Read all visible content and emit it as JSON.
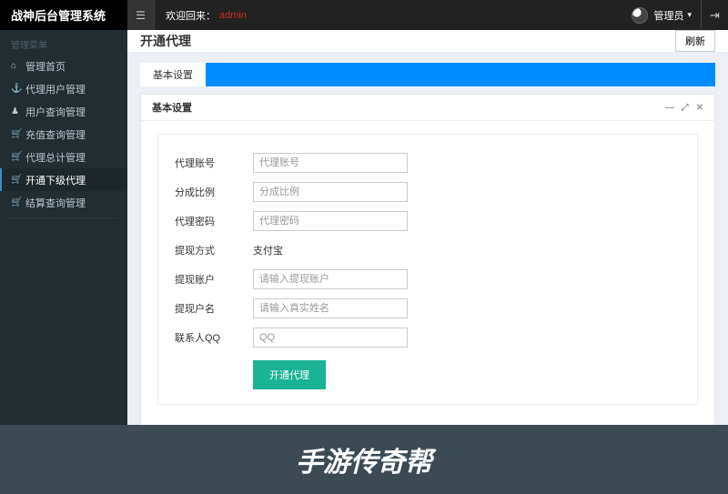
{
  "header": {
    "brand": "战神后台管理系统",
    "welcome_prefix": "欢迎回来：",
    "username": "admin",
    "role_label": "管理员"
  },
  "sidebar": {
    "section_label": "管理菜单",
    "items": [
      {
        "icon": "home-icon",
        "label": "管理首页",
        "glyph": "⌂"
      },
      {
        "icon": "sitemap-icon",
        "label": "代理用户管理",
        "glyph": "⚓"
      },
      {
        "icon": "user-icon",
        "label": "用户查询管理",
        "glyph": "♟"
      },
      {
        "icon": "cart-icon",
        "label": "充值查询管理",
        "glyph": "🛒"
      },
      {
        "icon": "cart-icon",
        "label": "代理总计管理",
        "glyph": "🛒"
      },
      {
        "icon": "cart-icon",
        "label": "开通下级代理",
        "glyph": "🛒",
        "active": true
      },
      {
        "icon": "cart-icon",
        "label": "结算查询管理",
        "glyph": "🛒"
      }
    ]
  },
  "page": {
    "title": "开通代理",
    "refresh": "刷新"
  },
  "tabs": [
    {
      "label": "基本设置",
      "active": true
    }
  ],
  "panel": {
    "title": "基本设置"
  },
  "form": {
    "rows": [
      {
        "label": "代理账号",
        "type": "input",
        "placeholder": "代理账号",
        "name": "agent-account"
      },
      {
        "label": "分成比例",
        "type": "input",
        "placeholder": "分成比例",
        "name": "split-ratio"
      },
      {
        "label": "代理密码",
        "type": "input",
        "placeholder": "代理密码",
        "name": "agent-password"
      },
      {
        "label": "提现方式",
        "type": "static",
        "value": "支付宝",
        "name": "withdraw-method"
      },
      {
        "label": "提现账户",
        "type": "input",
        "placeholder": "请输入提现账户",
        "name": "withdraw-account"
      },
      {
        "label": "提现户名",
        "type": "input",
        "placeholder": "请输入真实姓名",
        "name": "withdraw-name"
      },
      {
        "label": "联系人QQ",
        "type": "input",
        "placeholder": "QQ",
        "name": "contact-qq"
      }
    ],
    "submit_label": "开通代理"
  },
  "footer": {
    "text": "手游传奇帮"
  }
}
